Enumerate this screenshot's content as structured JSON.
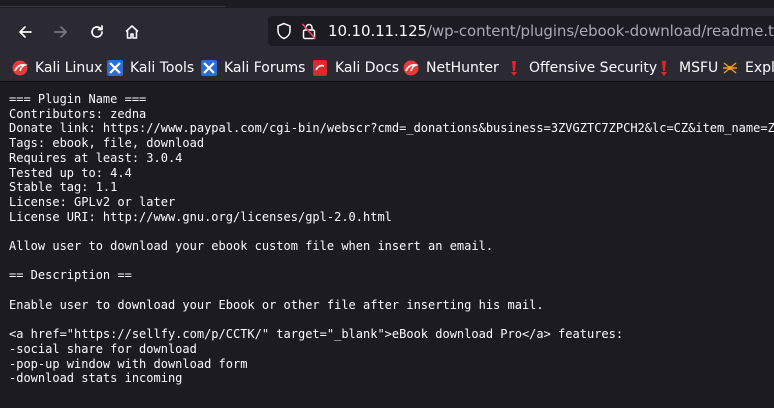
{
  "toolbar": {
    "url_host": "10.10.11.125",
    "url_path": "/wp-content/plugins/ebook-download/readme.txt"
  },
  "bookmarks": [
    {
      "label": "Kali Linux",
      "icon": "kali-dragon-icon"
    },
    {
      "label": "Kali Tools",
      "icon": "kali-tools-icon"
    },
    {
      "label": "Kali Forums",
      "icon": "kali-forums-icon"
    },
    {
      "label": "Kali Docs",
      "icon": "kali-docs-icon"
    },
    {
      "label": "NetHunter",
      "icon": "nethunter-icon"
    },
    {
      "label": "Offensive Security",
      "icon": "offsec-icon"
    },
    {
      "label": "MSFU",
      "icon": "msfu-icon"
    },
    {
      "label": "Expl",
      "icon": "exploit-db-icon"
    }
  ],
  "readme_text": "=== Plugin Name ===\nContributors: zedna\nDonate link: https://www.paypal.com/cgi-bin/webscr?cmd=_donations&business=3ZVGZTC7ZPCH2&lc=CZ&item_name=Z\nTags: ebook, file, download\nRequires at least: 3.0.4\nTested up to: 4.4\nStable tag: 1.1\nLicense: GPLv2 or later\nLicense URI: http://www.gnu.org/licenses/gpl-2.0.html\n\nAllow user to download your ebook custom file when insert an email.\n\n== Description ==\n\nEnable user to download your Ebook or other file after inserting his mail.\n\n<a href=\"https://sellfy.com/p/CCTK/\" target=\"_blank\">eBook download Pro</a> features:\n-social share for download\n-pop-up window with download form\n-download stats incoming"
}
